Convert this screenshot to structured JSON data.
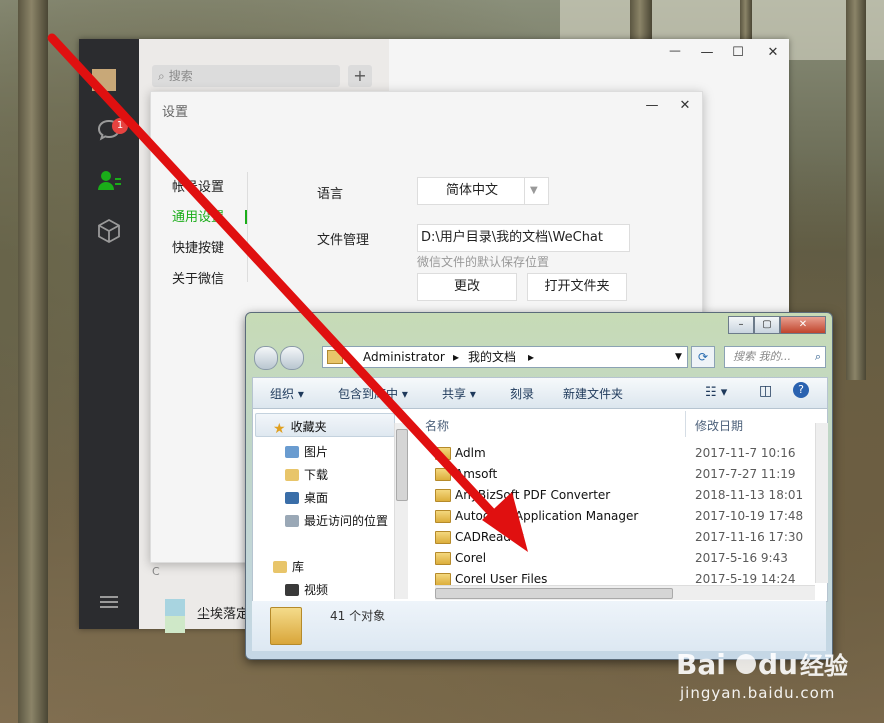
{
  "wechat": {
    "search_placeholder": "搜索",
    "add_label": "+",
    "badge_count": "1",
    "section_letter": "C",
    "chat_name": "尘埃落定",
    "win_controls": [
      "ᅳ",
      "—",
      "☐",
      "✕"
    ]
  },
  "settings": {
    "title": "设置",
    "menu": [
      "帐号设置",
      "通用设置",
      "快捷按键",
      "关于微信"
    ],
    "language_label": "语言",
    "language_value": "简体中文",
    "file_label": "文件管理",
    "file_path": "D:\\用户目录\\我的文档\\WeChat",
    "file_hint": "微信文件的默认保存位置",
    "change_button": "更改",
    "open_folder_button": "打开文件夹",
    "min": "—",
    "close": "✕"
  },
  "explorer": {
    "breadcrumb": [
      "Administrator",
      "▸",
      "我的文档",
      "▸"
    ],
    "search_placeholder": "搜索 我的...",
    "toolbar": [
      "组织 ▾",
      "包含到库中 ▾",
      "共享 ▾",
      "刻录",
      "新建文件夹"
    ],
    "nav": [
      "收藏夹",
      "图片",
      "下载",
      "桌面",
      "最近访问的位置",
      "库",
      "视频"
    ],
    "columns": [
      "名称",
      "修改日期"
    ],
    "files": [
      {
        "name": "Adlm",
        "date": "2017-11-7 10:16"
      },
      {
        "name": "Amsoft",
        "date": "2017-7-27 11:19"
      },
      {
        "name": "AnyBizSoft PDF Converter",
        "date": "2018-11-13 18:01"
      },
      {
        "name": "Autodesk Application Manager",
        "date": "2017-10-19 17:48"
      },
      {
        "name": "CADReader",
        "date": "2017-11-16 17:30"
      },
      {
        "name": "Corel",
        "date": "2017-5-16 9:43"
      },
      {
        "name": "Corel User Files",
        "date": "2017-5-19 14:24"
      }
    ],
    "status": "41 个对象"
  },
  "watermark": {
    "logo": "Bai du 经验",
    "url": "jingyan.baidu.com"
  },
  "colors": {
    "wechat_green": "#1aad19",
    "arrow_red": "#e01010",
    "badge_red": "#e64340"
  }
}
